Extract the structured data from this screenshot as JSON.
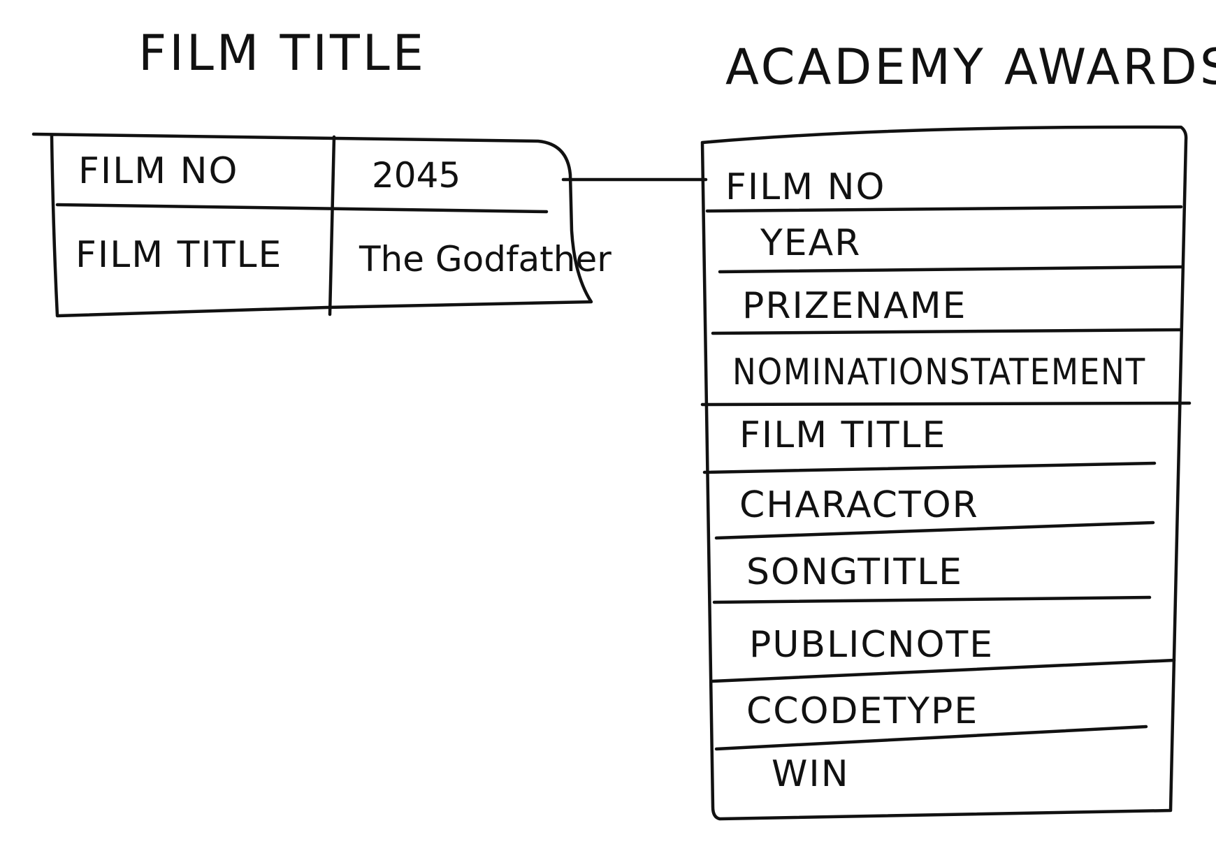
{
  "ink_color": "#111111",
  "background_color": "#ffffff",
  "film_title_table": {
    "heading": "FILM TITLE",
    "rows": [
      {
        "field": "FILM NO",
        "value": "2045"
      },
      {
        "field": "FILM TITLE",
        "value": "The Godfather"
      }
    ]
  },
  "academy_awards_table": {
    "heading": "ACADEMY AWARDS",
    "fields": [
      "FILM NO",
      "YEAR",
      "PRIZENAME",
      "NOMINATIONSTATEMENT",
      "FILM TITLE",
      "CHARACTOR",
      "SONGTITLE",
      "PUBLICNOTE",
      "CCODETYPE",
      "WIN"
    ]
  },
  "relationship": {
    "from": "FILM NO",
    "to": "FILM NO"
  }
}
